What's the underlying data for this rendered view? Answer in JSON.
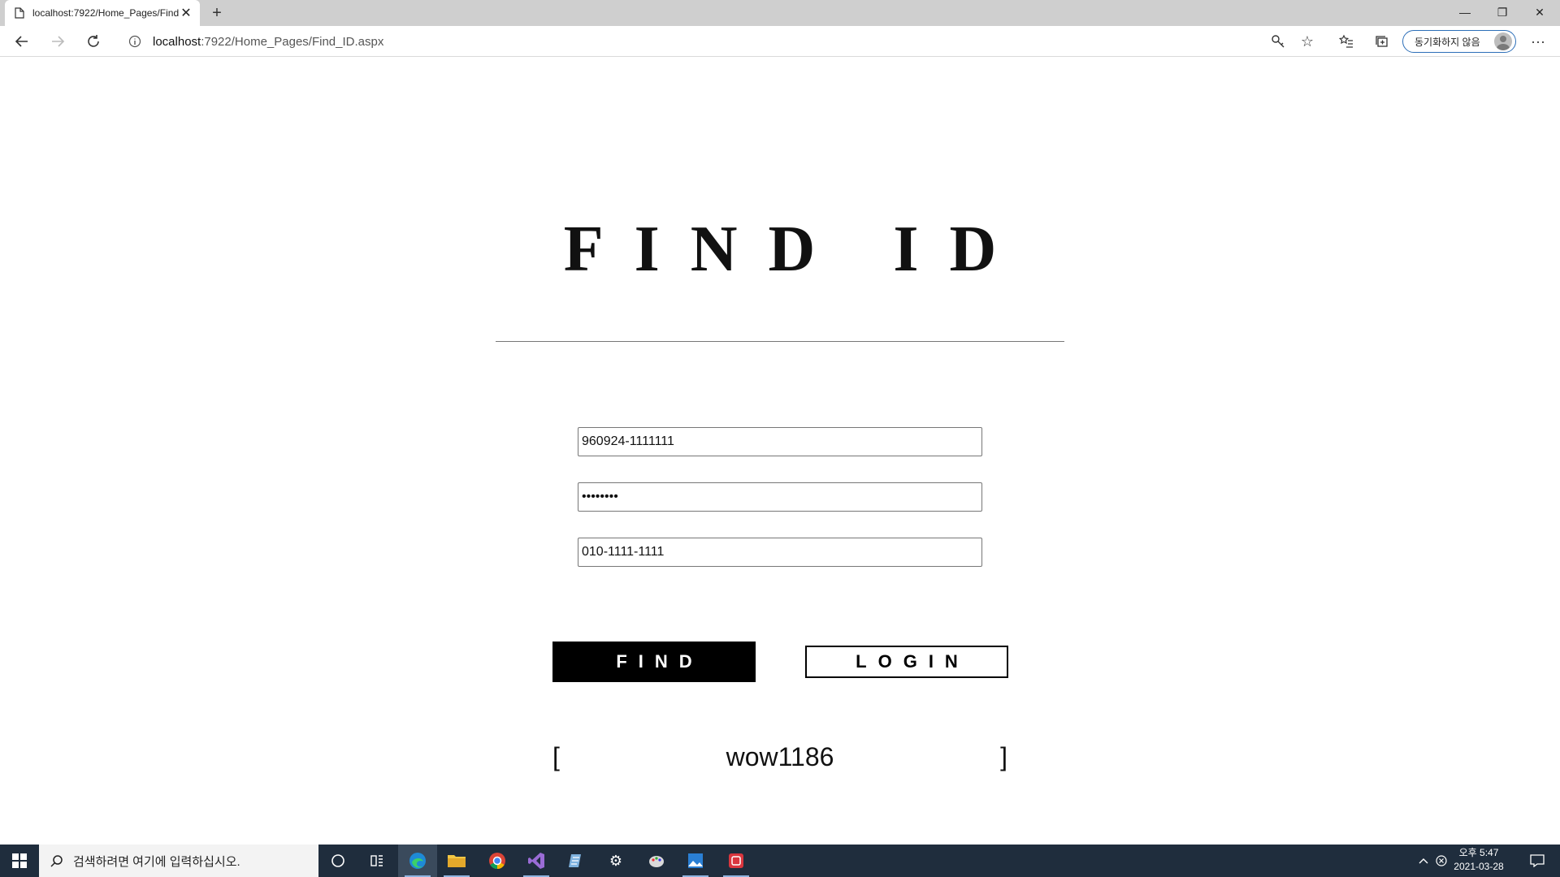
{
  "browser": {
    "tab_title": "localhost:7922/Home_Pages/Find",
    "url_host": "localhost",
    "url_path": ":7922/Home_Pages/Find_ID.aspx",
    "profile_label": "동기화하지 않음"
  },
  "page": {
    "title": "FIND ID",
    "fields": {
      "resident_number": "960924-1111111",
      "password": "12345678",
      "phone": "010-1111-1111"
    },
    "find_label": "FIND",
    "login_label": "LOGIN",
    "result": {
      "open_bracket": "[",
      "value": "wow1186",
      "close_bracket": "]"
    }
  },
  "taskbar": {
    "search_placeholder": "검색하려면 여기에 입력하십시오.",
    "time": "오후 5:47",
    "date": "2021-03-28"
  },
  "colors": {
    "taskbar_bg": "#1f2d3d",
    "find_button_bg": "#000000",
    "profile_border": "#2d6fb8"
  }
}
